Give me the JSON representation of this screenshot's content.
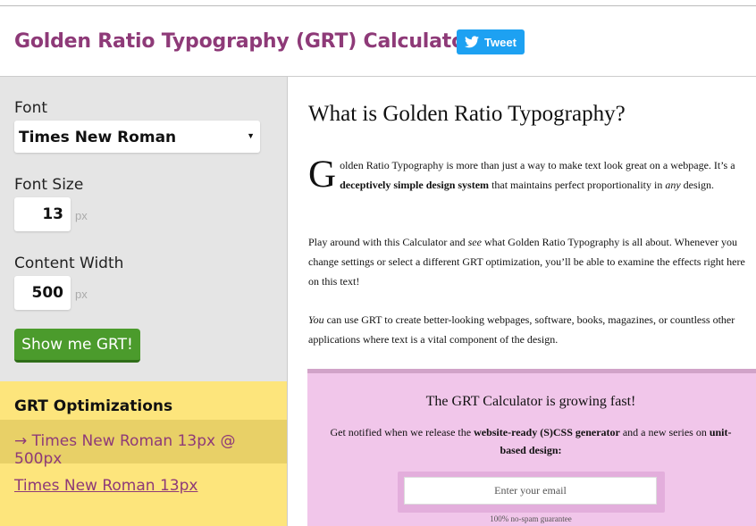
{
  "header": {
    "title": "Golden Ratio Typography (GRT) Calculator",
    "tweet_label": "Tweet",
    "tweet_icon": "twitter-bird-icon",
    "accent": "#8e3a78",
    "tweet_color": "#1da1f2"
  },
  "sidebar": {
    "font_label": "Font",
    "font_value": "Times New Roman",
    "font_size_label": "Font Size",
    "font_size_value": "13",
    "font_size_unit": "px",
    "content_width_label": "Content Width",
    "content_width_value": "500",
    "content_width_unit": "px",
    "show_button": "Show me GRT!",
    "button_color": "#4b9b2c"
  },
  "optimizations": {
    "heading": "GRT Optimizations",
    "active": "→ Times New Roman 13px @ 500px",
    "link": "Times New Roman 13px",
    "background": "#fde57c"
  },
  "main": {
    "heading": "What is Golden Ratio Typography?",
    "p1": {
      "dropcap": "G",
      "text_a": "olden Ratio Typography is more than just a way to make text look great on a webpage. It’s a ",
      "bold": "deceptively simple design system",
      "text_b": " that maintains perfect proportionality in ",
      "italic": "any",
      "text_c": " design."
    },
    "p2": {
      "text_a": "Play around with this Calculator and ",
      "italic": "see",
      "text_b": " what Golden Ratio Typography is all about. Whenever you change settings or select a different GRT optimization, you’ll be able to examine the effects right here on this text!"
    },
    "p3": {
      "italic": "You",
      "text": " can use GRT to create better-looking webpages, software, books, magazines, or countless other applications where text is a vital component of the design."
    }
  },
  "promo": {
    "title": "The GRT Calculator is growing fast!",
    "desc_a": "Get notified when we release the ",
    "desc_bold1": "website-ready (S)CSS generator",
    "desc_b": " and a new series on ",
    "desc_bold2": "unit-based design:",
    "email_placeholder": "Enter your email",
    "guarantee": "100% no-spam guarantee",
    "background": "#f1c6ea"
  }
}
